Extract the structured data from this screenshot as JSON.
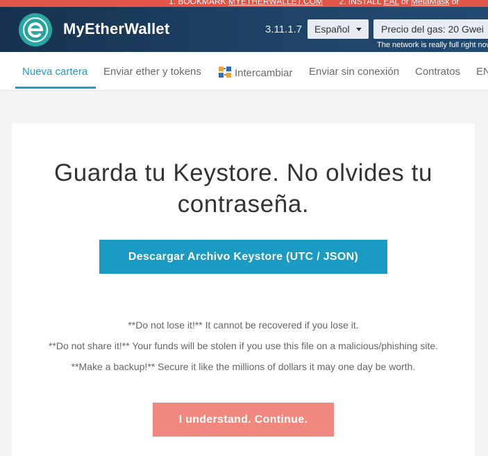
{
  "announcement": {
    "step1_prefix": "1. BOOKMARK ",
    "step1_link": "MYETHERWALLET.COM",
    "step2_prefix": "2. INSTALL ",
    "step2_link1": "EAL",
    "step2_or": " or ",
    "step2_link2": "MetaMask",
    "step2_suffix": " or"
  },
  "header": {
    "brand": "MyEtherWallet",
    "version": "3.11.1.7",
    "language": "Español",
    "gas_price": "Precio del gas: 20 Gwei",
    "gas_note": "The network is really full right now"
  },
  "nav": {
    "items": [
      {
        "label": "Nueva cartera"
      },
      {
        "label": "Enviar ether y tokens"
      },
      {
        "label": "Intercambiar"
      },
      {
        "label": "Enviar sin conexión"
      },
      {
        "label": "Contratos"
      },
      {
        "label": "ENS"
      }
    ]
  },
  "main": {
    "title": "Guarda tu Keystore. No olvides tu contraseña.",
    "download_label": "Descargar Archivo Keystore (UTC / JSON)",
    "warnings": [
      "**Do not lose it!** It cannot be recovered if you lose it.",
      "**Do not share it!** Your funds will be stolen if you use this file on a malicious/phishing site.",
      "**Make a backup!** Secure it like the millions of dollars it may one day be worth."
    ],
    "continue_label": "I understand. Continue."
  },
  "colors": {
    "accent": "#1a9bc4",
    "header_bg": "#1e3a5a",
    "announcement_bg": "#e2564a",
    "continue_bg": "#f08880"
  }
}
